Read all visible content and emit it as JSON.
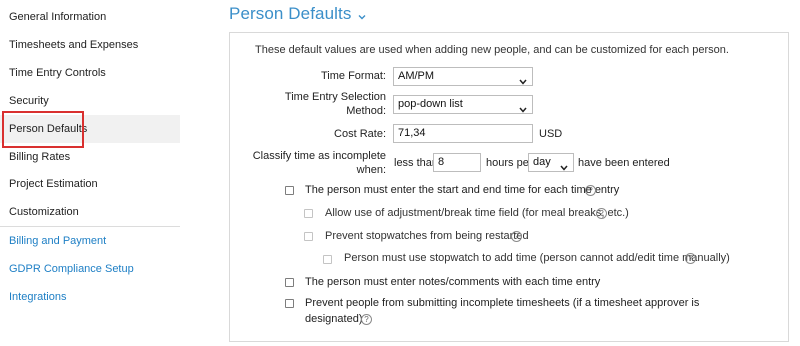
{
  "sidebar": {
    "items": [
      {
        "label": "General Information"
      },
      {
        "label": "Timesheets and Expenses"
      },
      {
        "label": "Time Entry Controls"
      },
      {
        "label": "Security"
      },
      {
        "label": "Person Defaults",
        "active": true
      },
      {
        "label": "Billing Rates"
      },
      {
        "label": "Project Estimation"
      },
      {
        "label": "Customization"
      },
      {
        "label": "Billing and Payment"
      },
      {
        "label": "GDPR Compliance Setup"
      },
      {
        "label": "Integrations"
      }
    ]
  },
  "page": {
    "title": "Person Defaults"
  },
  "panel": {
    "intro": "These default values are used when adding new people, and can be customized for each person.",
    "time_format": {
      "label": "Time Format:",
      "value": "AM/PM"
    },
    "entry_method": {
      "label_line1": "Time Entry Selection",
      "label_line2": "Method:",
      "value": "pop-down list"
    },
    "cost_rate": {
      "label": "Cost Rate:",
      "value": "71,34",
      "unit": "USD"
    },
    "classify": {
      "label_line1": "Classify time as incomplete",
      "label_line2": "when:",
      "prefix": "less than",
      "hours_value": "8",
      "hours_per": "hours per",
      "period_value": "day",
      "suffix": "have been entered"
    },
    "checks": {
      "start_end": "The person must enter the start and end time for each time entry",
      "adjustment": "Allow use of adjustment/break time field (for meal breaks, etc.)",
      "prevent_restart": "Prevent stopwatches from being restarted",
      "stopwatch_only": "Person must use stopwatch to add time (person cannot add/edit time manually)",
      "notes": "The person must enter notes/comments with each time entry",
      "prevent_incomplete_line1": "Prevent people from submitting incomplete timesheets (if a timesheet approver is",
      "prevent_incomplete_line2": "designated)"
    },
    "help_glyph": "?"
  },
  "colors": {
    "accent": "#3b8fc9",
    "link": "#1e7fc5",
    "highlight": "#d9302f"
  }
}
